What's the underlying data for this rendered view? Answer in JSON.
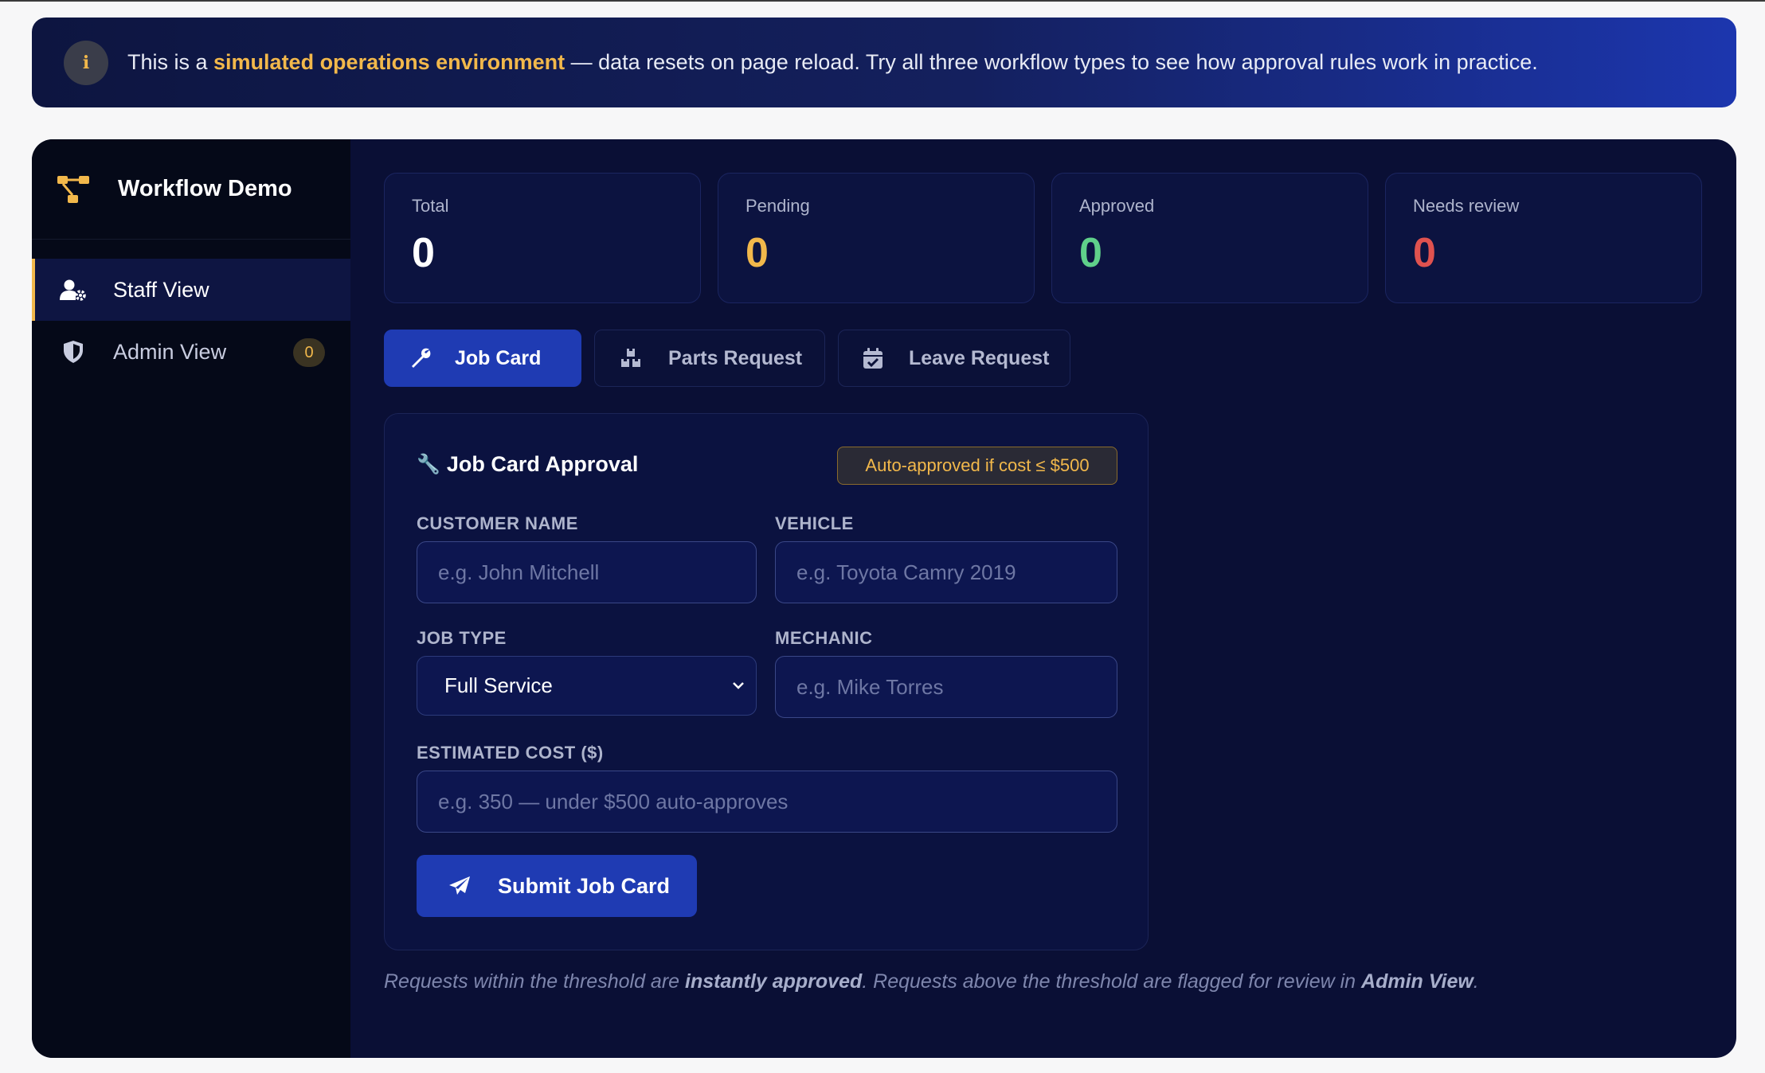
{
  "banner": {
    "icon": "info-icon",
    "icon_glyph": "i",
    "text_before": "This is a ",
    "highlight": "simulated operations environment",
    "text_after": " — data resets on page reload. Try all three workflow types to see how approval rules work in practice."
  },
  "sidebar": {
    "brand_icon": "workflow-icon",
    "title": "Workflow Demo",
    "items": [
      {
        "label": "Staff View",
        "icon": "user-gear-icon",
        "active": true
      },
      {
        "label": "Admin View",
        "icon": "shield-icon",
        "active": false,
        "badge": "0"
      }
    ]
  },
  "stats": [
    {
      "label": "Total",
      "value": "0",
      "color": "#ffffff"
    },
    {
      "label": "Pending",
      "value": "0",
      "color": "#f2b84b"
    },
    {
      "label": "Approved",
      "value": "0",
      "color": "#5fd08a"
    },
    {
      "label": "Needs review",
      "value": "0",
      "color": "#e0524f"
    }
  ],
  "tabs": [
    {
      "label": "Job Card",
      "icon": "wrench-icon",
      "active": true
    },
    {
      "label": "Parts Request",
      "icon": "boxes-icon",
      "active": false
    },
    {
      "label": "Leave Request",
      "icon": "calendar-check-icon",
      "active": false
    }
  ],
  "form": {
    "title_icon": "🔧",
    "title": "Job Card Approval",
    "rule_badge": "Auto-approved if cost ≤ $500",
    "fields": {
      "customer_name": {
        "label": "CUSTOMER NAME",
        "placeholder": "e.g. John Mitchell"
      },
      "vehicle": {
        "label": "VEHICLE",
        "placeholder": "e.g. Toyota Camry 2019"
      },
      "job_type": {
        "label": "JOB TYPE",
        "value": "Full Service"
      },
      "mechanic": {
        "label": "MECHANIC",
        "placeholder": "e.g. Mike Torres"
      },
      "estimated_cost": {
        "label": "ESTIMATED COST ($)",
        "placeholder": "e.g. 350 — under $500 auto-approves"
      }
    },
    "submit_label": "Submit Job Card",
    "submit_icon": "paper-plane-icon"
  },
  "footnote": {
    "p1": "Requests within the threshold are ",
    "b1": "instantly approved",
    "p2": ". Requests above the threshold are flagged for review in ",
    "b2": "Admin View",
    "p3": "."
  },
  "colors": {
    "accent": "#f2b84b",
    "primary": "#1f3bb3",
    "panel": "#0a0f35",
    "sidebar": "#050918"
  }
}
